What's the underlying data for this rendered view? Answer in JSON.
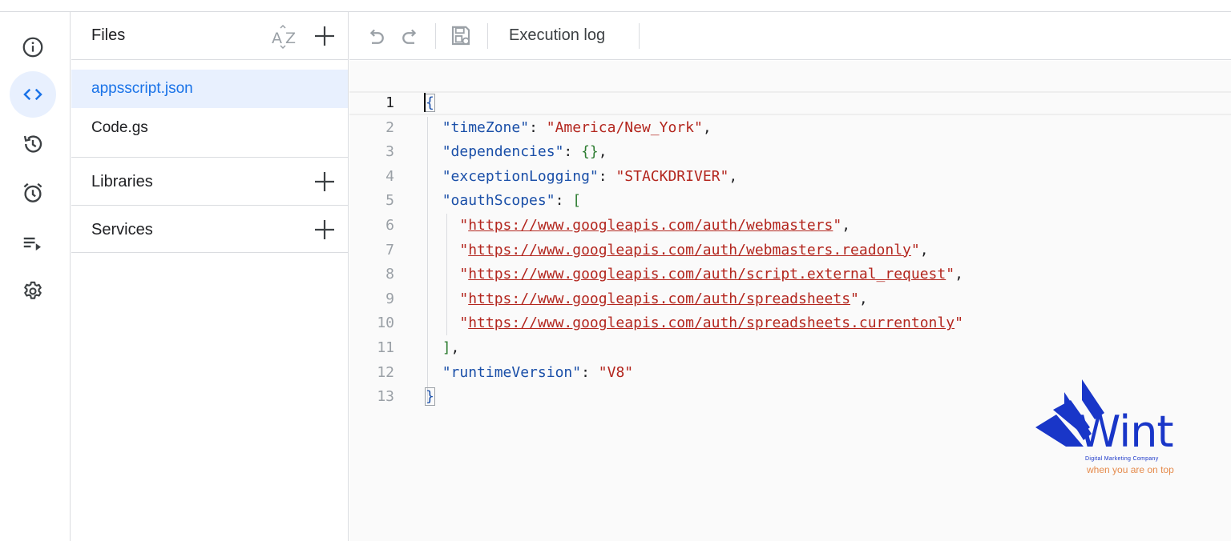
{
  "rail": {
    "items": [
      {
        "icon": "info-icon",
        "active": false
      },
      {
        "icon": "code-icon",
        "active": true
      },
      {
        "icon": "history-icon",
        "active": false
      },
      {
        "icon": "alarm-clock-icon",
        "active": false
      },
      {
        "icon": "executions-icon",
        "active": false
      },
      {
        "icon": "gear-icon",
        "active": false
      }
    ],
    "active_color": "#e8f0fe"
  },
  "files_panel": {
    "title": "Files",
    "sort_icon": "sort-az-icon",
    "add_icon": "plus-icon",
    "files": [
      {
        "name": "appsscript.json",
        "active": true
      },
      {
        "name": "Code.gs",
        "active": false
      }
    ],
    "libraries_label": "Libraries",
    "services_label": "Services"
  },
  "toolbar": {
    "undo_icon": "undo-icon",
    "redo_icon": "redo-icon",
    "save_icon": "save-icon",
    "execution_log_label": "Execution log"
  },
  "editor": {
    "current_line": 1,
    "lines": [
      {
        "n": "1",
        "tokens": [
          {
            "t": "{",
            "c": "bb"
          }
        ]
      },
      {
        "n": "2",
        "tokens": [
          {
            "t": "  ",
            "c": "p"
          },
          {
            "t": "\"timeZone\"",
            "c": "k"
          },
          {
            "t": ": ",
            "c": "p"
          },
          {
            "t": "\"America/New_York\"",
            "c": "s"
          },
          {
            "t": ",",
            "c": "p"
          }
        ]
      },
      {
        "n": "3",
        "tokens": [
          {
            "t": "  ",
            "c": "p"
          },
          {
            "t": "\"dependencies\"",
            "c": "k"
          },
          {
            "t": ": ",
            "c": "p"
          },
          {
            "t": "{}",
            "c": "b"
          },
          {
            "t": ",",
            "c": "p"
          }
        ]
      },
      {
        "n": "4",
        "tokens": [
          {
            "t": "  ",
            "c": "p"
          },
          {
            "t": "\"exceptionLogging\"",
            "c": "k"
          },
          {
            "t": ": ",
            "c": "p"
          },
          {
            "t": "\"STACKDRIVER\"",
            "c": "s"
          },
          {
            "t": ",",
            "c": "p"
          }
        ]
      },
      {
        "n": "5",
        "tokens": [
          {
            "t": "  ",
            "c": "p"
          },
          {
            "t": "\"oauthScopes\"",
            "c": "k"
          },
          {
            "t": ": ",
            "c": "p"
          },
          {
            "t": "[",
            "c": "b"
          }
        ]
      },
      {
        "n": "6",
        "tokens": [
          {
            "t": "    ",
            "c": "p"
          },
          {
            "t": "\"",
            "c": "s"
          },
          {
            "t": "https://www.googleapis.com/auth/webmasters",
            "c": "u"
          },
          {
            "t": "\"",
            "c": "s"
          },
          {
            "t": ",",
            "c": "p"
          }
        ]
      },
      {
        "n": "7",
        "tokens": [
          {
            "t": "    ",
            "c": "p"
          },
          {
            "t": "\"",
            "c": "s"
          },
          {
            "t": "https://www.googleapis.com/auth/webmasters.readonly",
            "c": "u"
          },
          {
            "t": "\"",
            "c": "s"
          },
          {
            "t": ",",
            "c": "p"
          }
        ]
      },
      {
        "n": "8",
        "tokens": [
          {
            "t": "    ",
            "c": "p"
          },
          {
            "t": "\"",
            "c": "s"
          },
          {
            "t": "https://www.googleapis.com/auth/script.external_request",
            "c": "u"
          },
          {
            "t": "\"",
            "c": "s"
          },
          {
            "t": ",",
            "c": "p"
          }
        ]
      },
      {
        "n": "9",
        "tokens": [
          {
            "t": "    ",
            "c": "p"
          },
          {
            "t": "\"",
            "c": "s"
          },
          {
            "t": "https://www.googleapis.com/auth/spreadsheets",
            "c": "u"
          },
          {
            "t": "\"",
            "c": "s"
          },
          {
            "t": ",",
            "c": "p"
          }
        ]
      },
      {
        "n": "10",
        "tokens": [
          {
            "t": "    ",
            "c": "p"
          },
          {
            "t": "\"",
            "c": "s"
          },
          {
            "t": "https://www.googleapis.com/auth/spreadsheets.currentonly",
            "c": "u"
          },
          {
            "t": "\"",
            "c": "s"
          }
        ]
      },
      {
        "n": "11",
        "tokens": [
          {
            "t": "  ",
            "c": "p"
          },
          {
            "t": "]",
            "c": "b"
          },
          {
            "t": ",",
            "c": "p"
          }
        ]
      },
      {
        "n": "12",
        "tokens": [
          {
            "t": "  ",
            "c": "p"
          },
          {
            "t": "\"runtimeVersion\"",
            "c": "k"
          },
          {
            "t": ": ",
            "c": "p"
          },
          {
            "t": "\"V8\"",
            "c": "s"
          }
        ]
      },
      {
        "n": "13",
        "tokens": [
          {
            "t": "}",
            "c": "bb"
          }
        ]
      }
    ]
  },
  "watermark": {
    "brand": "Wint",
    "tagline": "Digital Marketing Company",
    "slogan": "when you are on top",
    "brand_color": "#1936c8",
    "slogan_color": "#e58a4b"
  }
}
